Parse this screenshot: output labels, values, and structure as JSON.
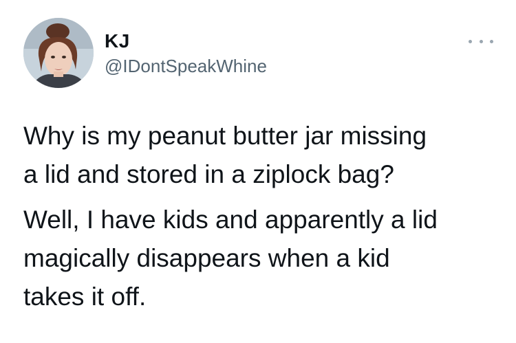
{
  "tweet": {
    "author": {
      "name": "KJ",
      "handle": "@IDontSpeakWhine"
    },
    "more_icon": "more-horizontal-icon",
    "paragraphs": [
      [
        "Why is my peanut butter jar missing",
        "a lid and stored in a ziplock bag?"
      ],
      [
        "Well, I have kids and apparently a lid",
        "magically disappears when a kid",
        "takes it off."
      ]
    ]
  }
}
